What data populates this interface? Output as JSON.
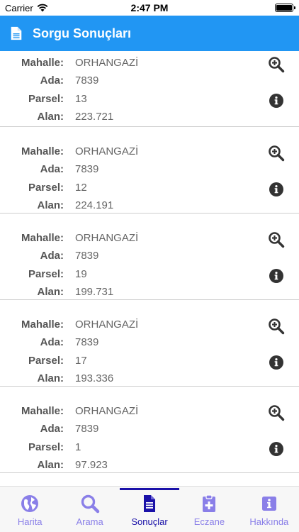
{
  "status_bar": {
    "carrier": "Carrier",
    "time": "2:47 PM"
  },
  "app_bar": {
    "title": "Sorgu Sonuçları",
    "icon": "document-icon"
  },
  "labels": {
    "mahalle": "Mahalle:",
    "ada": "Ada:",
    "parsel": "Parsel:",
    "alan": "Alan:"
  },
  "results": [
    {
      "mahalle": "ORHANGAZİ",
      "ada": "7839",
      "parsel": "13",
      "alan": "223.721"
    },
    {
      "mahalle": "ORHANGAZİ",
      "ada": "7839",
      "parsel": "12",
      "alan": "224.191"
    },
    {
      "mahalle": "ORHANGAZİ",
      "ada": "7839",
      "parsel": "19",
      "alan": "199.731"
    },
    {
      "mahalle": "ORHANGAZİ",
      "ada": "7839",
      "parsel": "17",
      "alan": "193.336"
    },
    {
      "mahalle": "ORHANGAZİ",
      "ada": "7839",
      "parsel": "1",
      "alan": "97.923"
    }
  ],
  "tabs": [
    {
      "label": "Harita",
      "icon": "globe-icon",
      "active": false
    },
    {
      "label": "Arama",
      "icon": "search-icon",
      "active": false
    },
    {
      "label": "Sonuçlar",
      "icon": "document-icon",
      "active": true
    },
    {
      "label": "Eczane",
      "icon": "medical-clipboard-icon",
      "active": false
    },
    {
      "label": "Hakkında",
      "icon": "info-icon",
      "active": false
    }
  ],
  "colors": {
    "app_bar": "#2196f3",
    "tab_active": "#1a11a8",
    "tab_inactive": "#8a7fe8",
    "action_icon": "#333333"
  }
}
